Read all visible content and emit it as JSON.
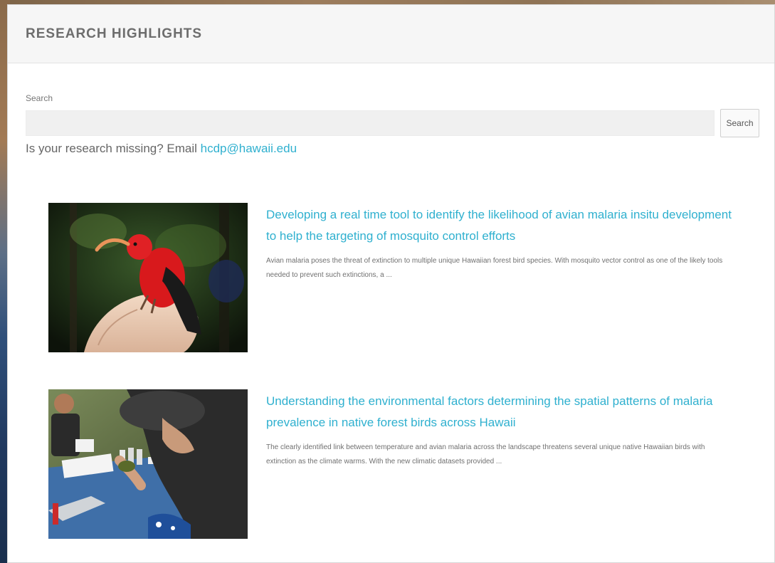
{
  "header": {
    "title": "RESEARCH HIGHLIGHTS"
  },
  "search": {
    "label": "Search",
    "value": "",
    "placeholder": "",
    "button_label": "Search"
  },
  "missing": {
    "text": "Is your research missing? Email ",
    "email": "hcdp@hawaii.edu"
  },
  "results": [
    {
      "title": "Developing a real time tool to identify the likelihood of avian malaria insitu development to help the targeting of mosquito control efforts",
      "excerpt": "Avian malaria poses the threat of extinction to multiple unique Hawaiian forest bird species. With mosquito vector control as one of the likely tools needed to prevent such extinctions, a ..."
    },
    {
      "title": "Understanding the environmental factors determining the spatial patterns of malaria prevalence in native forest birds across Hawaii",
      "excerpt": "The clearly identified link between temperature and avian malaria across the landscape threatens several unique native Hawaiian birds with extinction as the climate warms. With the new climatic datasets provided ..."
    }
  ],
  "colors": {
    "accent": "#2fb0cf",
    "title_gray": "#6d6d6d",
    "text_gray": "#707070"
  }
}
